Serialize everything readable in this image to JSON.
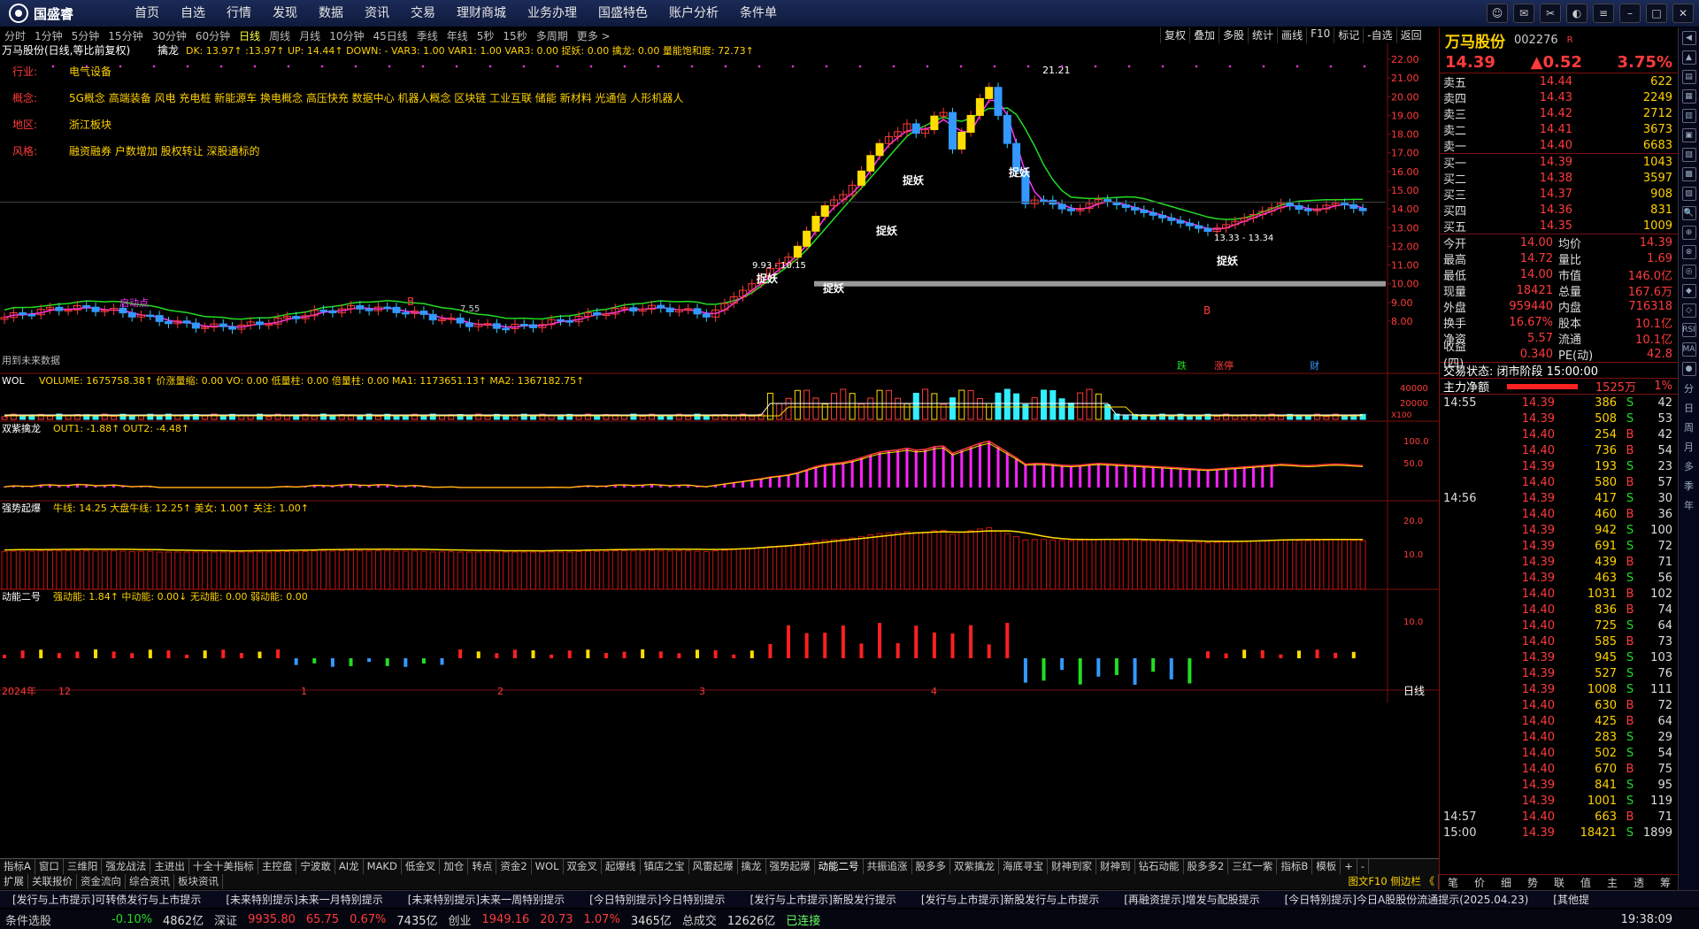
{
  "app": {
    "logo_text": "国盛睿"
  },
  "menu": [
    "首页",
    "自选",
    "行情",
    "发现",
    "数据",
    "资讯",
    "交易",
    "理财商城",
    "业务办理",
    "国盛特色",
    "账户分析",
    "条件单"
  ],
  "window_controls": [
    "chat-icon",
    "mail-icon",
    "tool-icon",
    "skin-icon",
    "menu-icon",
    "min-icon",
    "max-icon",
    "close-icon"
  ],
  "periods": [
    "分时",
    "1分钟",
    "5分钟",
    "15分钟",
    "30分钟",
    "60分钟",
    "日线",
    "周线",
    "月线",
    "10分钟",
    "45日线",
    "季线",
    "年线",
    "5秒",
    "15秒",
    "多周期",
    "更多 >"
  ],
  "active_period": "日线",
  "right_toolbar": [
    "复权",
    "叠加",
    "多股",
    "统计",
    "画线",
    "F10",
    "标记",
    "-自选",
    "返回"
  ],
  "main": {
    "title": "万马股份(日线,等比前复权)",
    "ind_name": "擒龙",
    "ind_values": "DK: 13.97↑  :13.97↑  UP: 14.44↑  DOWN: -  VAR3: 1.00  VAR1: 1.00  VAR3: 0.00  捉妖: 0.00  擒龙: 0.00  量能饱和度: 72.73↑",
    "info": [
      {
        "k": "行业:",
        "v": "电气设备"
      },
      {
        "k": "概念:",
        "v": "5G概念 高端装备 风电 充电桩 新能源车 换电概念 高压快充 数据中心 机器人概念 区块链 工业互联 储能 新材料 光通信 人形机器人"
      },
      {
        "k": "地区:",
        "v": "浙江板块"
      },
      {
        "k": "风格:",
        "v": "融资融券 户数增加 股权转让 深股通标的"
      }
    ],
    "annotations": {
      "peak": "21.21",
      "low": "7.55",
      "range1": "9.93 - 10.15",
      "range2": "13.33 - 13.34",
      "zhuoyao": "捉妖",
      "qidong": "启动点",
      "bottom_text": "用到未来数据",
      "b": "B"
    },
    "event_labels": [
      "跌",
      "涨停",
      "财"
    ],
    "y_axis": [
      "22.00",
      "21.00",
      "20.00",
      "19.00",
      "18.00",
      "17.00",
      "16.00",
      "15.00",
      "14.00",
      "13.00",
      "12.00",
      "11.00",
      "10.00",
      "9.00",
      "8.00"
    ]
  },
  "vol_panel": {
    "title": "WOL",
    "values": "VOLUME: 1675758.38↑  价涨量缩: 0.00  VO: 0.00  低量柱: 0.00  倍量柱: 0.00  MA1: 1173651.13↑  MA2: 1367182.75↑",
    "axis": [
      "40000",
      "20000"
    ],
    "unit": "X100"
  },
  "panel2": {
    "title": "双紫擒龙",
    "values": "OUT1: -1.88↑  OUT2: -4.48↑",
    "axis": [
      "100.0",
      "50.0"
    ]
  },
  "panel3": {
    "title": "强势起爆",
    "values": "牛线: 14.25  大盘牛线: 12.25↑  美女: 1.00↑  关注: 1.00↑",
    "axis": [
      "20.0",
      "10.0"
    ]
  },
  "panel4": {
    "title": "动能二号",
    "values": "强动能: 1.84↑  中动能: 0.00↓  无动能: 0.00  弱动能: 0.00",
    "axis": [
      "10.0"
    ]
  },
  "x_axis": {
    "labels": [
      "2024年",
      "12",
      "1",
      "2",
      "3",
      "4"
    ],
    "mode": "日线"
  },
  "quote": {
    "name": "万马股份",
    "code": "002276",
    "tag": "R",
    "price": "14.39",
    "change": "▲0.52",
    "pct": "3.75%",
    "sells": [
      {
        "l": "卖五",
        "p": "14.44",
        "v": "622"
      },
      {
        "l": "卖四",
        "p": "14.43",
        "v": "2249"
      },
      {
        "l": "卖三",
        "p": "14.42",
        "v": "2712"
      },
      {
        "l": "卖二",
        "p": "14.41",
        "v": "3673"
      },
      {
        "l": "卖一",
        "p": "14.40",
        "v": "6683"
      }
    ],
    "buys": [
      {
        "l": "买一",
        "p": "14.39",
        "v": "1043"
      },
      {
        "l": "买二",
        "p": "14.38",
        "v": "3597"
      },
      {
        "l": "买三",
        "p": "14.37",
        "v": "908"
      },
      {
        "l": "买四",
        "p": "14.36",
        "v": "831"
      },
      {
        "l": "买五",
        "p": "14.35",
        "v": "1009"
      }
    ],
    "stats": [
      {
        "k1": "今开",
        "v1": "14.00",
        "k2": "均价",
        "v2": "14.39"
      },
      {
        "k1": "最高",
        "v1": "14.72",
        "k2": "量比",
        "v2": "1.69"
      },
      {
        "k1": "最低",
        "v1": "14.00",
        "k2": "市值",
        "v2": "146.0亿"
      },
      {
        "k1": "现量",
        "v1": "18421",
        "k2": "总量",
        "v2": "167.6万"
      },
      {
        "k1": "外盘",
        "v1": "959440",
        "k2": "内盘",
        "v2": "716318"
      },
      {
        "k1": "换手",
        "v1": "16.67%",
        "k2": "股本",
        "v2": "10.1亿"
      },
      {
        "k1": "净资",
        "v1": "5.57",
        "k2": "流通",
        "v2": "10.1亿"
      },
      {
        "k1": "收益(四)",
        "v1": "0.340",
        "k2": "PE(动)",
        "v2": "42.8"
      }
    ],
    "trade_state": "交易状态: 闭市阶段 15:00:00",
    "main_flow_label": "主力净额",
    "main_flow_val": "1525万",
    "main_flow_pct": "1%",
    "ticks": [
      {
        "t": "14:55",
        "p": "14.39",
        "v": "386",
        "s": "S",
        "n": "42"
      },
      {
        "t": "",
        "p": "14.39",
        "v": "508",
        "s": "S",
        "n": "53"
      },
      {
        "t": "",
        "p": "14.40",
        "v": "254",
        "s": "B",
        "n": "42"
      },
      {
        "t": "",
        "p": "14.40",
        "v": "736",
        "s": "B",
        "n": "54"
      },
      {
        "t": "",
        "p": "14.39",
        "v": "193",
        "s": "S",
        "n": "23"
      },
      {
        "t": "",
        "p": "14.40",
        "v": "580",
        "s": "B",
        "n": "57"
      },
      {
        "t": "14:56",
        "p": "14.39",
        "v": "417",
        "s": "S",
        "n": "30"
      },
      {
        "t": "",
        "p": "14.40",
        "v": "460",
        "s": "B",
        "n": "36"
      },
      {
        "t": "",
        "p": "14.39",
        "v": "942",
        "s": "S",
        "n": "100"
      },
      {
        "t": "",
        "p": "14.39",
        "v": "691",
        "s": "S",
        "n": "72"
      },
      {
        "t": "",
        "p": "14.39",
        "v": "439",
        "s": "B",
        "n": "71"
      },
      {
        "t": "",
        "p": "14.39",
        "v": "463",
        "s": "S",
        "n": "56"
      },
      {
        "t": "",
        "p": "14.40",
        "v": "1031",
        "s": "B",
        "n": "102"
      },
      {
        "t": "",
        "p": "14.40",
        "v": "836",
        "s": "B",
        "n": "74"
      },
      {
        "t": "",
        "p": "14.40",
        "v": "725",
        "s": "S",
        "n": "64"
      },
      {
        "t": "",
        "p": "14.40",
        "v": "585",
        "s": "B",
        "n": "73"
      },
      {
        "t": "",
        "p": "14.39",
        "v": "945",
        "s": "S",
        "n": "103"
      },
      {
        "t": "",
        "p": "14.39",
        "v": "527",
        "s": "S",
        "n": "76"
      },
      {
        "t": "",
        "p": "14.39",
        "v": "1008",
        "s": "S",
        "n": "111"
      },
      {
        "t": "",
        "p": "14.40",
        "v": "630",
        "s": "B",
        "n": "72"
      },
      {
        "t": "",
        "p": "14.40",
        "v": "425",
        "s": "B",
        "n": "64"
      },
      {
        "t": "",
        "p": "14.40",
        "v": "283",
        "s": "S",
        "n": "29"
      },
      {
        "t": "",
        "p": "14.40",
        "v": "502",
        "s": "S",
        "n": "54"
      },
      {
        "t": "",
        "p": "14.40",
        "v": "670",
        "s": "B",
        "n": "75"
      },
      {
        "t": "",
        "p": "14.39",
        "v": "841",
        "s": "S",
        "n": "95"
      },
      {
        "t": "",
        "p": "14.39",
        "v": "1001",
        "s": "S",
        "n": "119"
      },
      {
        "t": "14:57",
        "p": "14.40",
        "v": "663",
        "s": "B",
        "n": "71"
      },
      {
        "t": "15:00",
        "p": "14.39",
        "v": "18421",
        "s": "S",
        "n": "1899"
      }
    ],
    "bottom_tabs": [
      "笔",
      "价",
      "细",
      "势",
      "联",
      "值",
      "主",
      "透",
      "筹"
    ]
  },
  "sidebar": [
    "◀",
    "▲",
    "▤",
    "▦",
    "▥",
    "▣",
    "▧",
    "▩",
    "▨",
    "🔍",
    "⊕",
    "⊗",
    "◎",
    "◆",
    "◇",
    "RSI",
    "MA",
    "●"
  ],
  "sidebar_text": [
    "分",
    "日",
    "周",
    "月",
    "多",
    "季",
    "年"
  ],
  "indicator_tabs": [
    "指标A",
    "窗口",
    "三维阳",
    "强龙战法",
    "主进出",
    "十全十美指标",
    "主控盘",
    "宁波敢",
    "AI龙",
    "MAKD",
    "低金叉",
    "加仓",
    "转点",
    "资金2",
    "WOL",
    "双金叉",
    "起爆线",
    "镇店之宝",
    "风雷起爆",
    "擒龙",
    "强势起爆",
    "动能二号",
    "共振追涨",
    "股多多",
    "双紫擒龙",
    "海底寻宝",
    "财神到家",
    "财神到",
    "钻石动能",
    "股多多2",
    "三红一紫",
    "指标B",
    "模板",
    "+",
    "-"
  ],
  "sub_tabs": [
    "扩展",
    "关联报价",
    "资金流向",
    "综合资讯",
    "板块资讯"
  ],
  "sub_tabs_right": "图文F10 侧边栏 《",
  "news": [
    "[发行与上市提示]可转债发行与上市提示",
    "[未来特别提示]未来一月特别提示",
    "[未来特别提示]未来一周特别提示",
    "[今日特别提示]今日特别提示",
    "[发行与上市提示]新股发行提示",
    "[发行与上市提示]新股发行与上市提示",
    "[再融资提示]增发与配股提示",
    "[今日特别提示]今日A股股份流通提示(2025.04.23)",
    "[其他提"
  ],
  "status": {
    "label": "条件选股",
    "idx_chg": "-0.10%",
    "idx_amt": "4862亿",
    "sz_lbl": "深证",
    "sz_val": "9935.80",
    "sz_chg": "65.75",
    "sz_pct": "0.67%",
    "sz_amt": "7435亿",
    "cy_lbl": "创业",
    "cy_val": "1949.16",
    "cy_chg": "20.73",
    "cy_pct": "1.07%",
    "cy_amt": "3465亿",
    "total_lbl": "总成交",
    "total": "12626亿",
    "conn": "已连接",
    "time": "19:38:09"
  }
}
